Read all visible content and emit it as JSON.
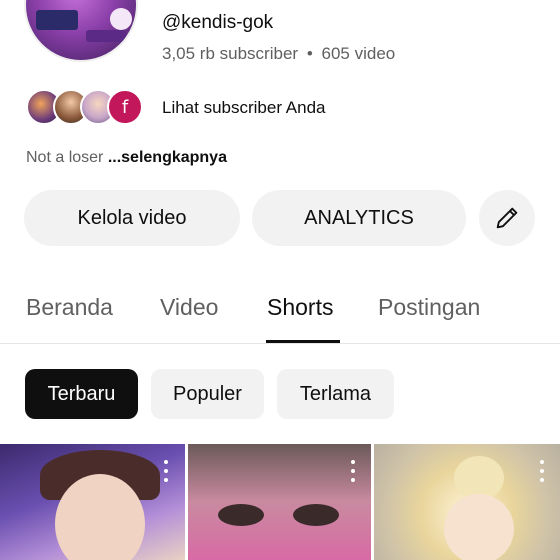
{
  "channel": {
    "handle": "@kendis-gok",
    "subscriber_count": "3,05 rb subscriber",
    "separator": "•",
    "video_count": "605 video",
    "subscribers_link": "Lihat subscriber Anda",
    "subscriber_avatar_letter": "f",
    "description_prefix": "Not a loser ",
    "description_more": "...selengkapnya"
  },
  "actions": {
    "manage_videos": "Kelola video",
    "analytics": "ANALYTICS",
    "edit_icon": "pencil-icon"
  },
  "tabs": [
    {
      "label": "Beranda",
      "active": false
    },
    {
      "label": "Video",
      "active": false
    },
    {
      "label": "Shorts",
      "active": true
    },
    {
      "label": "Postingan",
      "active": false
    }
  ],
  "chips": [
    {
      "label": "Terbaru",
      "active": true
    },
    {
      "label": "Populer",
      "active": false
    },
    {
      "label": "Terlama",
      "active": false
    }
  ],
  "colors": {
    "text_primary": "#0f0f0f",
    "text_secondary": "#606060",
    "chip_bg": "#f2f2f2",
    "active_chip_bg": "#0f0f0f",
    "avatar_badge": "#c2185b"
  }
}
